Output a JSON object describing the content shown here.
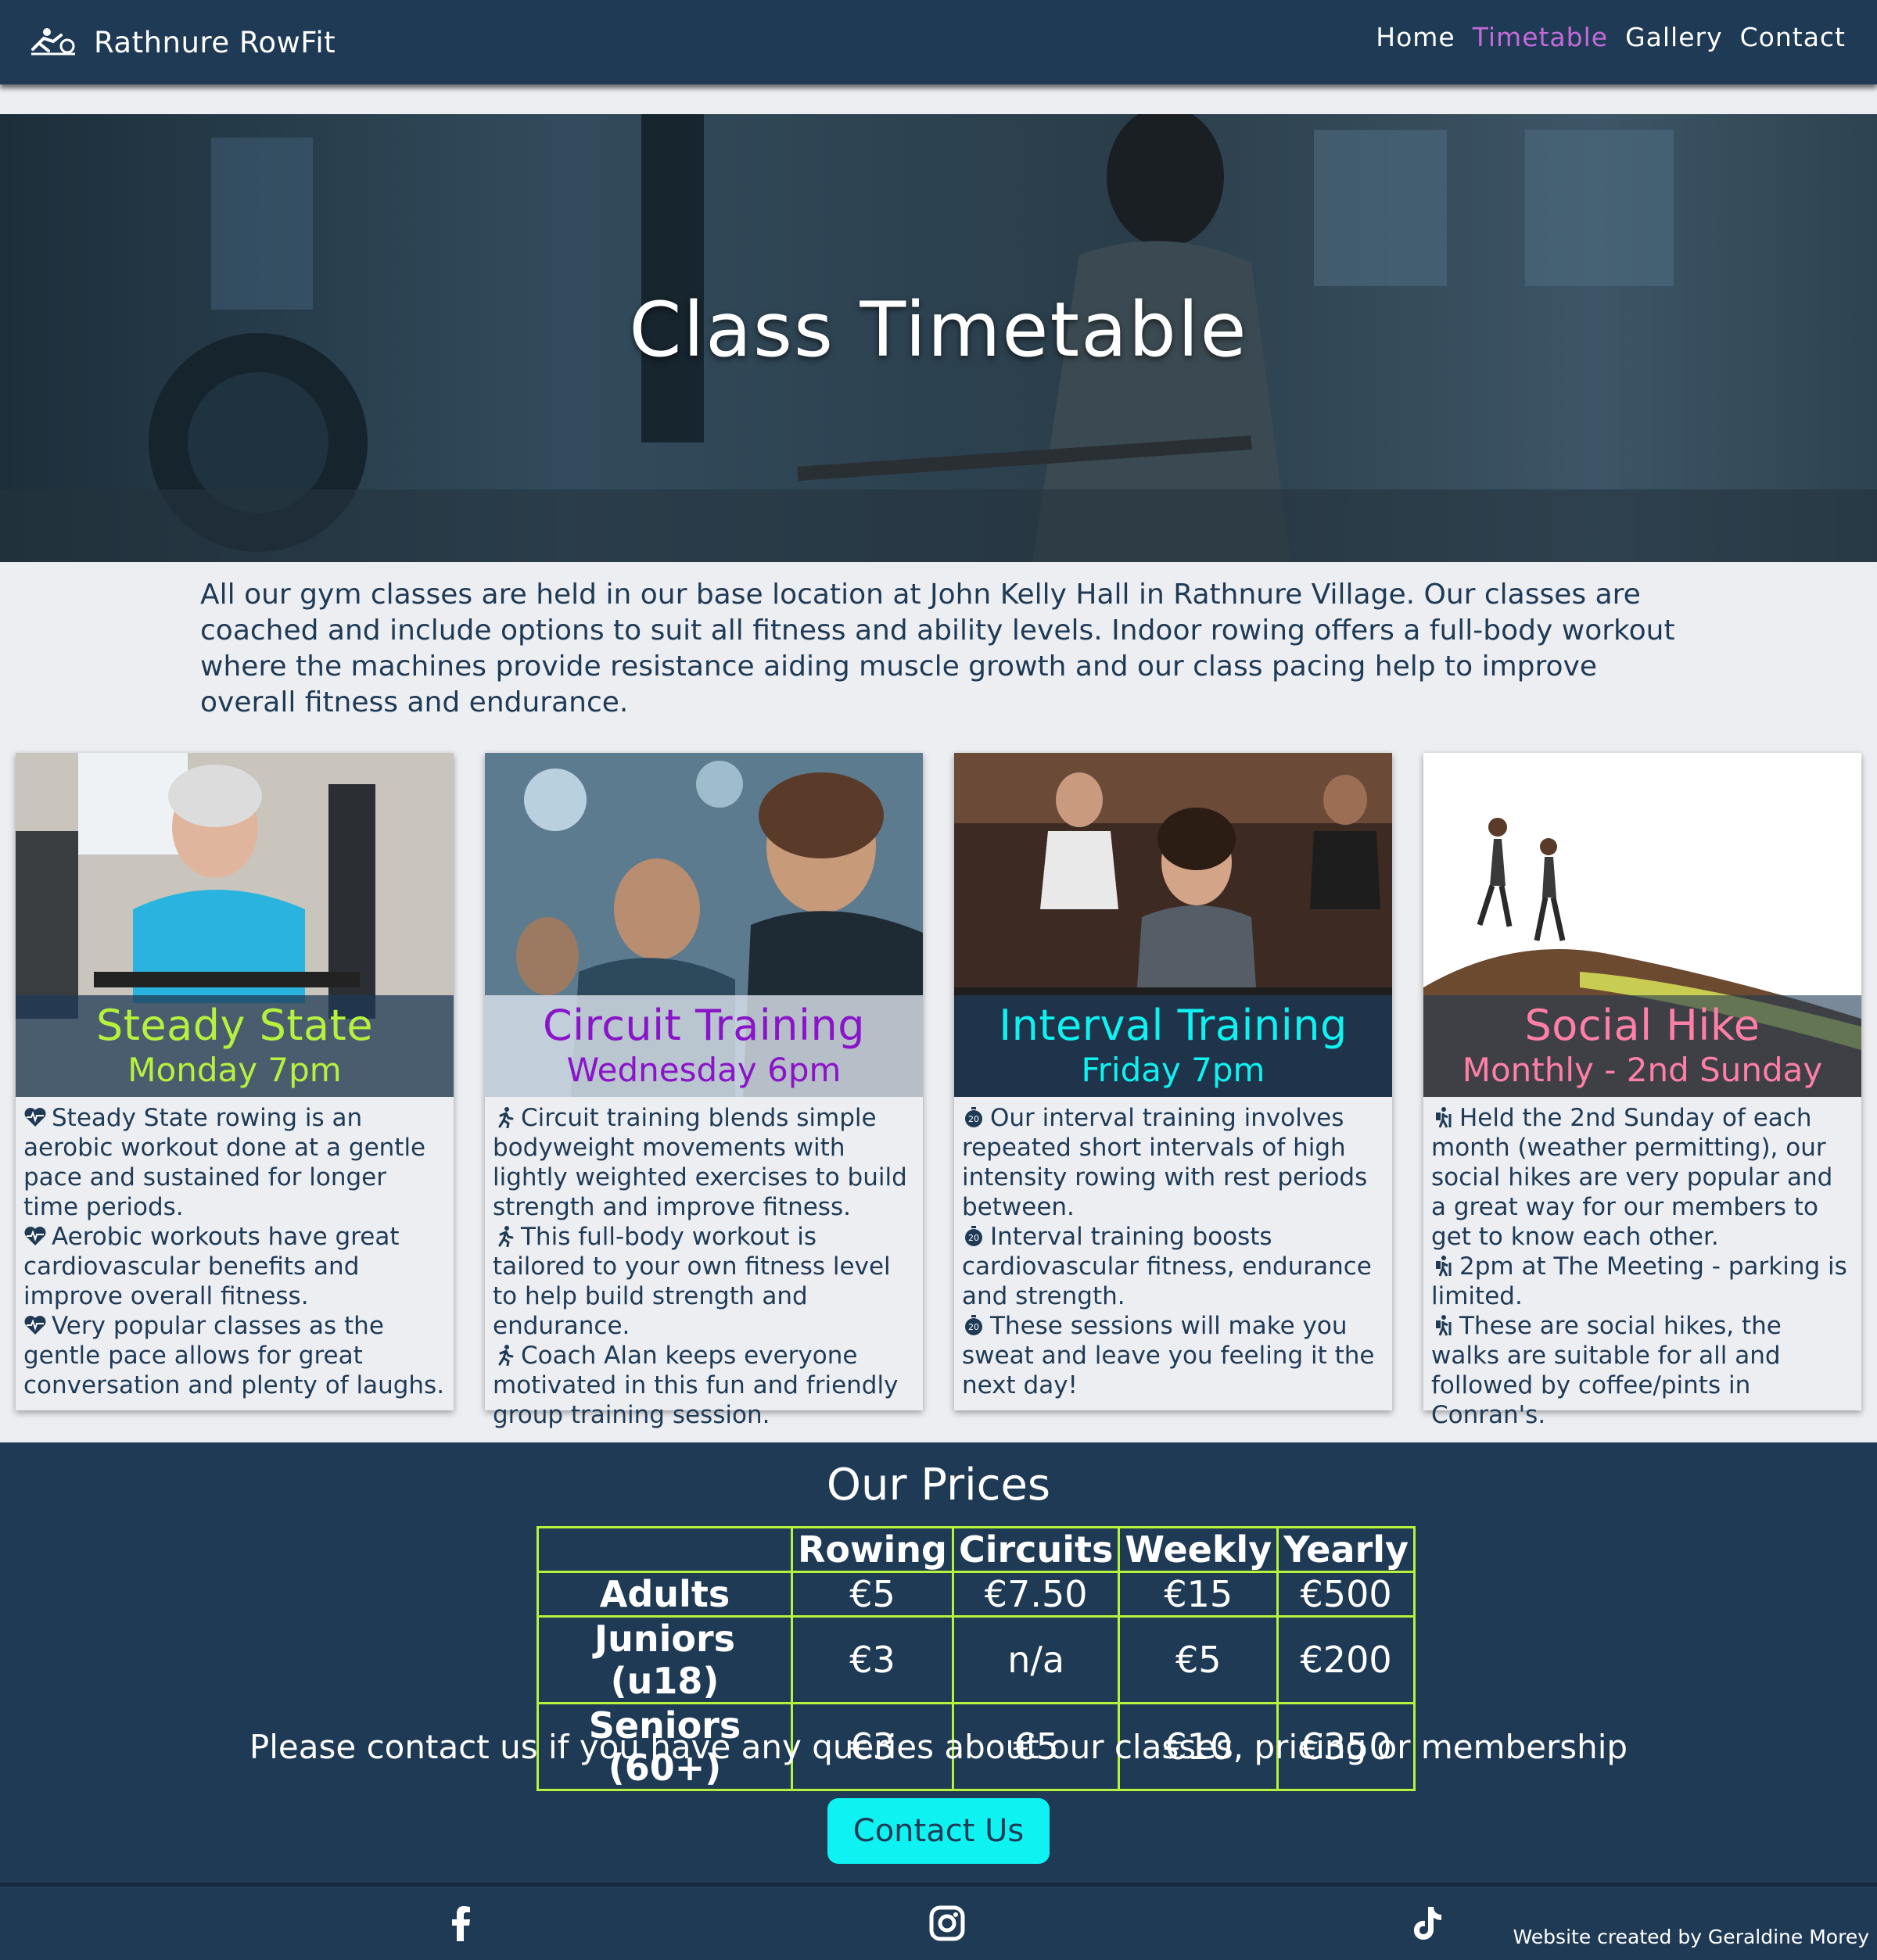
{
  "nav": {
    "brand": "Rathnure RowFit",
    "links": [
      "Home",
      "Timetable",
      "Gallery",
      "Contact"
    ],
    "active_link": "Timetable"
  },
  "hero": {
    "title": "Class Timetable"
  },
  "intro": "All our gym classes are held in our base location at John Kelly Hall in Rathnure Village. Our classes are coached and include options to suit all fitness and ability levels. Indoor rowing offers a full-body workout where the machines provide resistance aiding muscle growth and our class pacing help to improve overall fitness and endurance.",
  "cards": [
    {
      "title": "Steady State",
      "day": "Monday 7pm",
      "title_color": "#b6f23d",
      "icon": "heartbeat-icon",
      "points": [
        "Steady State rowing is an aerobic workout done at a gentle pace and sustained for longer time periods.",
        "Aerobic workouts have great cardiovascular benefits and improve overall fitness.",
        "Very popular classes as the gentle pace allows for great conversation and plenty of laughs."
      ]
    },
    {
      "title": "Circuit Training",
      "day": "Wednesday 6pm",
      "title_color": "#8a14c8",
      "icon": "running-person-icon",
      "points": [
        "Circuit training blends simple bodyweight movements with lightly weighted exercises to build strength and improve fitness.",
        "This full-body workout is tailored to your own fitness level to help build strength and endurance.",
        "Coach Alan keeps everyone motivated in this fun and friendly group training session."
      ]
    },
    {
      "title": "Interval Training",
      "day": "Friday 7pm",
      "title_color": "#0ff2f2",
      "icon": "stopwatch-20-icon",
      "points": [
        "Our interval training involves repeated short intervals of high intensity rowing with rest periods between.",
        "Interval training boosts cardiovascular fitness, endurance and strength.",
        "These sessions will make you sweat and leave you feeling it the next day!"
      ]
    },
    {
      "title": "Social Hike",
      "day": "Monthly - 2nd Sunday",
      "title_color": "#ff7fa6",
      "icon": "hiking-person-icon",
      "points": [
        "Held the 2nd Sunday of each month (weather permitting), our social hikes are very popular and a great way for our members to get to know each other.",
        "2pm at The Meeting - parking is limited.",
        "These are social hikes, the walks are suitable for all and followed by coffee/pints in Conran's."
      ]
    }
  ],
  "prices": {
    "title": "Our Prices",
    "columns": [
      "",
      "Rowing",
      "Circuits",
      "Weekly",
      "Yearly"
    ],
    "rows": [
      [
        "Adults",
        "€5",
        "€7.50",
        "€15",
        "€500"
      ],
      [
        "Juniors (u18)",
        "€3",
        "n/a",
        "€5",
        "€200"
      ],
      [
        "Seniors (60+)",
        "€3",
        "€5",
        "€10",
        "€350"
      ]
    ],
    "note": "Please contact us if you have any queries about our classes, pricing or membership",
    "button": "Contact Us"
  },
  "footer": {
    "social_icons": [
      "facebook-icon",
      "instagram-icon",
      "tiktok-icon"
    ],
    "credit": "Website created by Geraldine Morey"
  }
}
